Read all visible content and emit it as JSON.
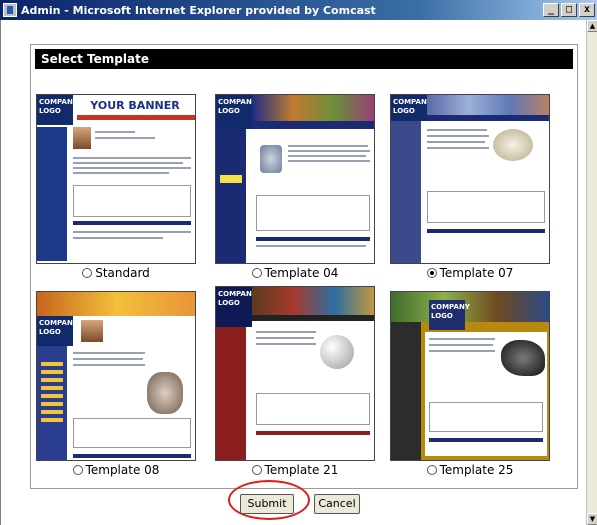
{
  "window": {
    "title": "Admin - Microsoft Internet Explorer provided by Comcast",
    "min_glyph": "_",
    "max_glyph": "□",
    "close_glyph": "x"
  },
  "panel": {
    "header": "Select Template"
  },
  "templates": [
    {
      "label": "Standard",
      "selected": false,
      "banner_text": "YOUR BANNER"
    },
    {
      "label": "Template 04",
      "selected": false
    },
    {
      "label": "Template 07",
      "selected": true
    },
    {
      "label": "Template 08",
      "selected": false
    },
    {
      "label": "Template 21",
      "selected": false
    },
    {
      "label": "Template 25",
      "selected": false
    }
  ],
  "thumb_text": {
    "logo": "COMPANY LOGO"
  },
  "buttons": {
    "submit": "Submit",
    "cancel": "Cancel"
  },
  "colors": {
    "title_bar": "#0a246a",
    "highlight": "#e21a1a"
  }
}
